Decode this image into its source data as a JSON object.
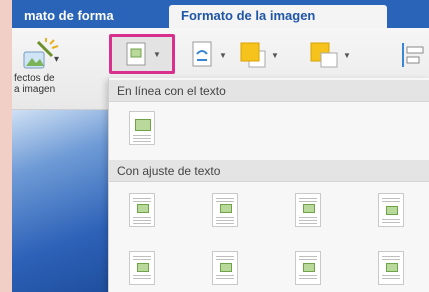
{
  "tabs": {
    "shape_format": "mato de forma",
    "picture_format": "Formato de la imagen"
  },
  "ribbon": {
    "effects_line1": "fectos de",
    "effects_line2": "a imagen"
  },
  "wrap_menu": {
    "inline_header": "En línea con el texto",
    "wrap_header": "Con ajuste de texto"
  },
  "colors": {
    "tabbar": "#2a64b8",
    "selection_highlight": "#d8308c",
    "picture_fill": "#b8d99a"
  },
  "icons": [
    "picture-effects-icon",
    "wrap-text-icon",
    "position-icon",
    "bring-forward-icon",
    "send-backward-icon",
    "align-icon"
  ]
}
